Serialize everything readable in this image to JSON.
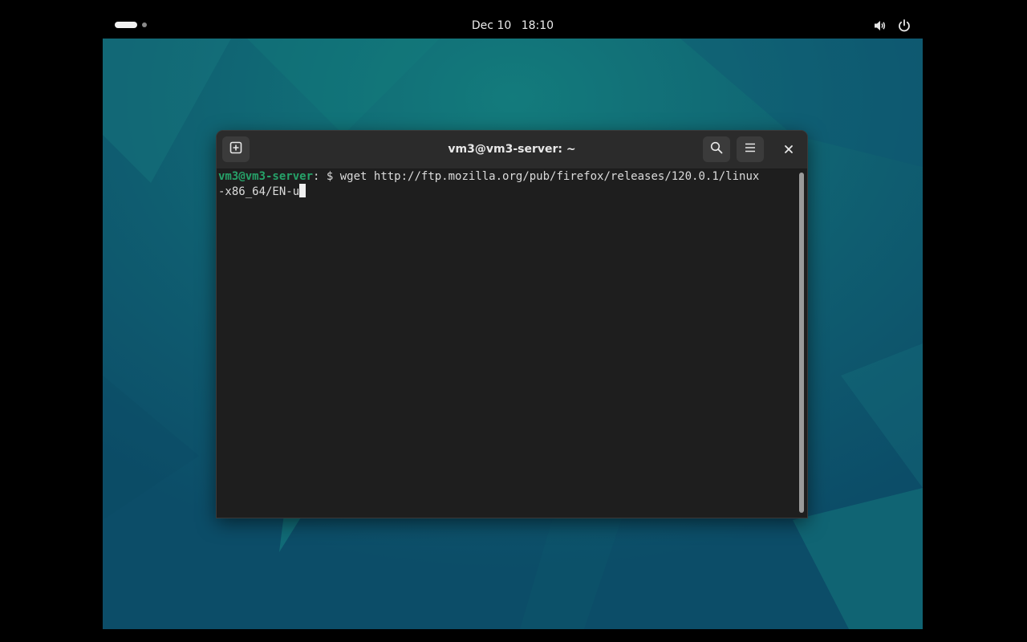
{
  "topbar": {
    "date": "Dec 10",
    "time": "18:10"
  },
  "icons": {
    "activities": "workspace-indicator",
    "volume": "speaker-icon",
    "power": "power-icon",
    "new_tab": "new-tab-icon",
    "search": "search-icon",
    "menu": "hamburger-menu-icon",
    "close": "close-icon"
  },
  "terminal": {
    "title": "vm3@vm3-server: ~",
    "prompt_user": "vm3@vm3-server",
    "prompt_sep": ":",
    "prompt_path": " $ ",
    "command_line1": "wget http://ftp.mozilla.org/pub/firefox/releases/120.0.1/linux",
    "command_line2": "-x86_64/EN-u"
  },
  "colors": {
    "prompt_user": "#26a269",
    "terminal_bg": "#1e1e1e",
    "headerbar_bg": "#2b2b2b"
  }
}
